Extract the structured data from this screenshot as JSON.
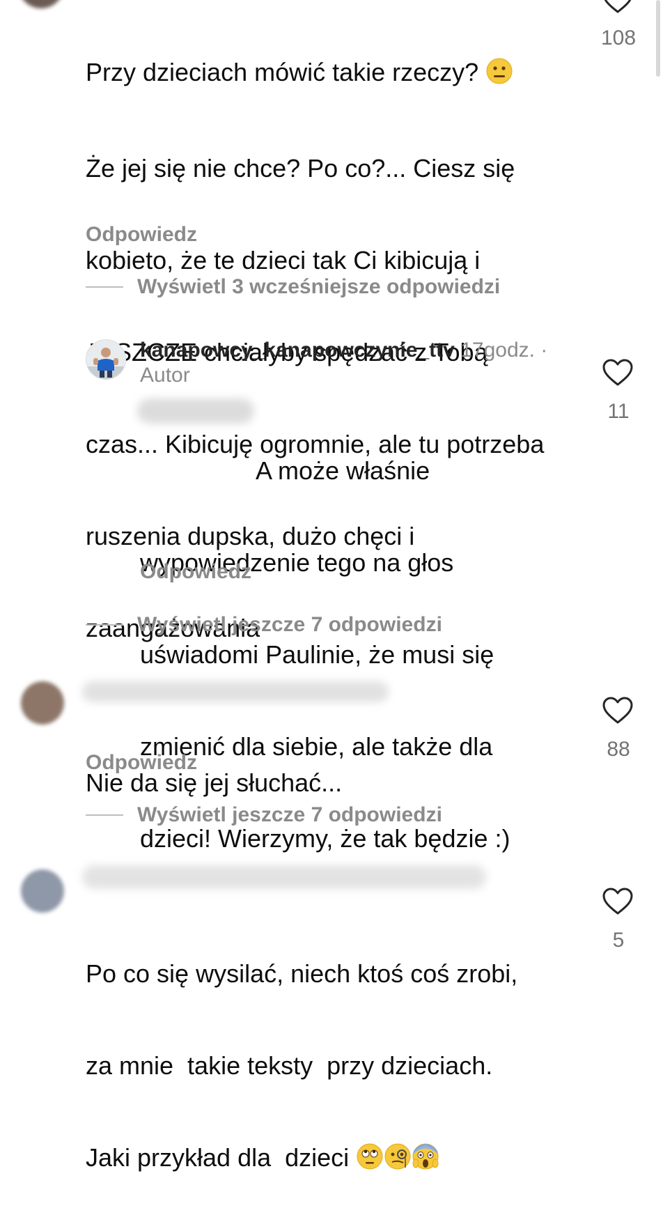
{
  "comments": [
    {
      "lines": [
        "Przy dzieciach mówić takie rzeczy?",
        "Że jej się nie chce? Po co?... Ciesz się",
        "kobieto, że te dzieci tak Ci kibicują i",
        "JESZCZE chciałyby spędzać z Tobą",
        "czas... Kibicuję ogromnie, ale tu potrzeba",
        "ruszenia dupska, dużo chęci i",
        "zaangażowania"
      ],
      "likes": "108",
      "reply_label": "Odpowiedz",
      "view_replies": "Wyświetl 3 wcześniejsze odpowiedzi"
    },
    {
      "username": "kanapowcy_kanapowczynie_ttv",
      "time": "17godz. ·",
      "badge": "Autor",
      "lines": [
        "A może właśnie",
        "wypowiedzenie tego na głos",
        "uświadomi Paulinie, że musi się",
        "zmienić dla siebie, ale także dla",
        "dzieci! Wierzymy, że tak będzie :)"
      ],
      "likes": "11",
      "reply_label": "Odpowiedz",
      "view_replies": "Wyświetl jeszcze 7 odpowiedzi"
    },
    {
      "lines": [
        "Nie da się jej słuchać..."
      ],
      "likes": "88",
      "reply_label": "Odpowiedz",
      "view_replies": "Wyświetl jeszcze 7 odpowiedzi"
    },
    {
      "lines": [
        "Po co się wysilać, niech ktoś coś zrobi,",
        "za mnie  takie teksty  przy dzieciach.",
        "Jaki przykład dla  dzieci"
      ],
      "likes": "5"
    }
  ],
  "icons": {
    "like": "heart-outline-icon",
    "emoji_neutral": "neutral-face-emoji",
    "emoji_eyeroll": "eye-roll-emoji",
    "emoji_monocle": "monocle-face-emoji",
    "emoji_scream": "screaming-face-emoji"
  },
  "colors": {
    "text": "#0d0d0d",
    "secondary": "#8a8a8a",
    "count": "#737373"
  }
}
